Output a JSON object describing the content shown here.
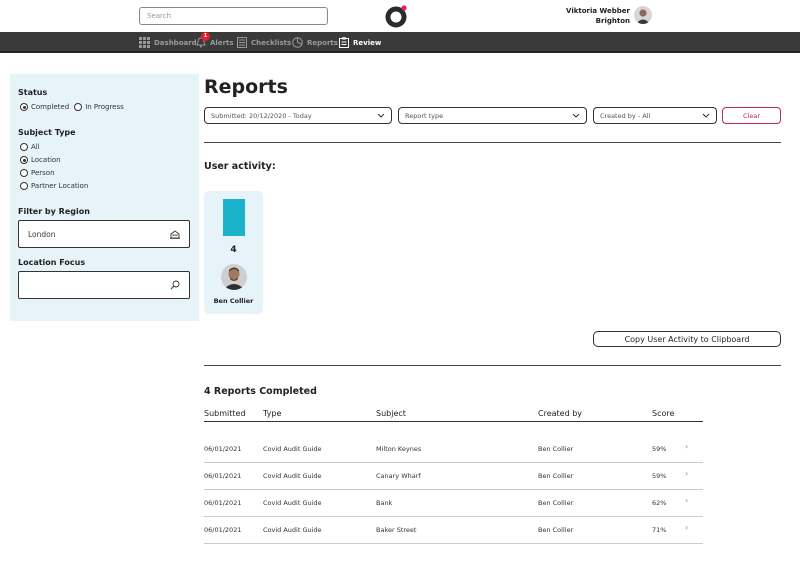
{
  "header": {
    "search_placeholder": "Search",
    "user_name": "Viktoria Webber",
    "user_location": "Brighton"
  },
  "nav": {
    "items": [
      {
        "label": "Dashboard",
        "icon": "grid-icon"
      },
      {
        "label": "Alerts",
        "icon": "bell-icon",
        "badge": "1"
      },
      {
        "label": "Checklists",
        "icon": "checklist-icon"
      },
      {
        "label": "Reports",
        "icon": "pie-chart-icon"
      },
      {
        "label": "Review",
        "icon": "clipboard-icon",
        "active": true
      }
    ]
  },
  "sidebar": {
    "status_heading": "Status",
    "status_options": [
      {
        "label": "Completed",
        "checked": true
      },
      {
        "label": "In Progress",
        "checked": false
      }
    ],
    "subject_heading": "Subject Type",
    "subject_options": [
      {
        "label": "All",
        "checked": false
      },
      {
        "label": "Location",
        "checked": true
      },
      {
        "label": "Person",
        "checked": false
      },
      {
        "label": "Partner Location",
        "checked": false
      }
    ],
    "region_heading": "Filter by Region",
    "region_value": "London",
    "location_heading": "Location Focus",
    "location_value": ""
  },
  "main": {
    "title": "Reports",
    "filters": {
      "submitted": "Submitted: 20/12/2020 - Today",
      "report_type": "Report type",
      "created_by": "Created by - All",
      "clear": "Clear"
    },
    "activity": {
      "heading": "User activity:",
      "users": [
        {
          "name": "Ben Collier",
          "count": "4"
        }
      ],
      "copy_button": "Copy User Activity to Clipboard"
    },
    "reports": {
      "heading": "4 Reports Completed",
      "columns": [
        "Submitted",
        "Type",
        "Subject",
        "Created by",
        "Score"
      ],
      "rows": [
        {
          "submitted": "06/01/2021",
          "type": "Covid Audit Guide",
          "subject": "Milton Keynes",
          "created_by": "Ben Collier",
          "score": "59%"
        },
        {
          "submitted": "06/01/2021",
          "type": "Covid Audit Guide",
          "subject": "Canary Wharf",
          "created_by": "Ben Collier",
          "score": "59%"
        },
        {
          "submitted": "06/01/2021",
          "type": "Covid Audit Guide",
          "subject": "Bank",
          "created_by": "Ben Collier",
          "score": "62%"
        },
        {
          "submitted": "06/01/2021",
          "type": "Covid Audit Guide",
          "subject": "Baker Street",
          "created_by": "Ben Collier",
          "score": "71%"
        }
      ]
    }
  },
  "colors": {
    "accent": "#1bb2cc",
    "clear": "#c4245a",
    "badge": "#e0212b",
    "navbar": "#3a3a3a",
    "sidebar": "#e6f3f8"
  }
}
